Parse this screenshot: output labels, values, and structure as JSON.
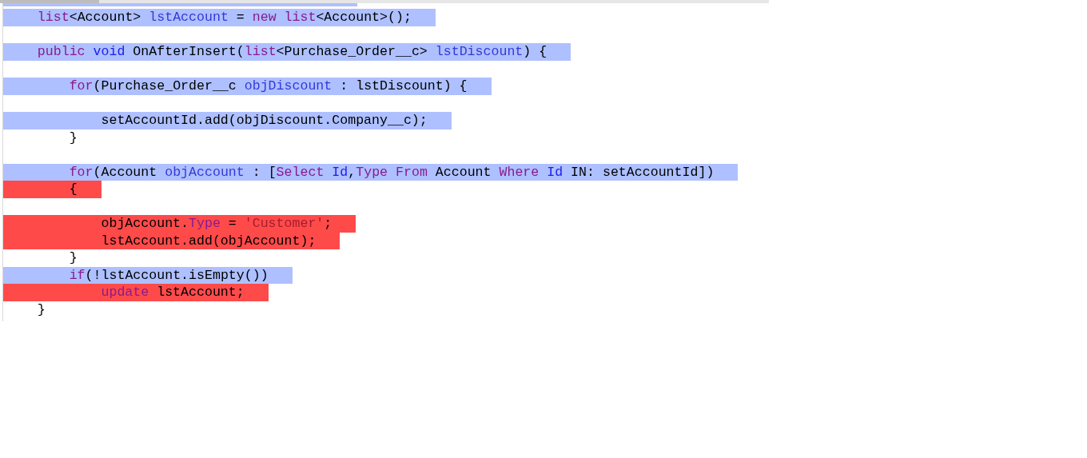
{
  "lines": [
    {
      "kind": "code",
      "color": "#aec0ff",
      "tokens": [
        {
          "kind": "keyword",
          "text": "    list"
        },
        {
          "kind": "plain",
          "text": "<Account> "
        },
        {
          "kind": "name",
          "text": "lstAccount"
        },
        {
          "kind": "plain",
          "text": " = "
        },
        {
          "kind": "keyword",
          "text": "new list"
        },
        {
          "kind": "plain",
          "text": "<Account>();"
        }
      ]
    },
    {
      "kind": "blank"
    },
    {
      "kind": "code",
      "color": "#aec0ff",
      "tokens": [
        {
          "kind": "keyword",
          "text": "    public "
        },
        {
          "kind": "builtin",
          "text": "void"
        },
        {
          "kind": "plain",
          "text": " OnAfterInsert("
        },
        {
          "kind": "keyword",
          "text": "list"
        },
        {
          "kind": "plain",
          "text": "<Purchase_Order__c> "
        },
        {
          "kind": "name",
          "text": "lstDiscount"
        },
        {
          "kind": "plain",
          "text": ") {"
        }
      ]
    },
    {
      "kind": "blank"
    },
    {
      "kind": "code",
      "color": "#aec0ff",
      "tokens": [
        {
          "kind": "keyword",
          "text": "        for"
        },
        {
          "kind": "plain",
          "text": "(Purchase_Order__c "
        },
        {
          "kind": "name",
          "text": "objDiscount"
        },
        {
          "kind": "plain",
          "text": " : lstDiscount) {"
        }
      ]
    },
    {
      "kind": "blank"
    },
    {
      "kind": "code",
      "color": "#aec0ff",
      "tokens": [
        {
          "kind": "plain",
          "text": "            setAccountId.add(objDiscount.Company__c);"
        }
      ]
    },
    {
      "kind": "code",
      "tokens": [
        {
          "kind": "plain",
          "text": "        }"
        }
      ]
    },
    {
      "kind": "blank"
    },
    {
      "kind": "code",
      "color": "#aec0ff",
      "tokens": [
        {
          "kind": "keyword",
          "text": "        for"
        },
        {
          "kind": "plain",
          "text": "(Account "
        },
        {
          "kind": "name",
          "text": "objAccount"
        },
        {
          "kind": "plain",
          "text": " : ["
        },
        {
          "kind": "keyword",
          "text": "Select "
        },
        {
          "kind": "builtin",
          "text": "Id"
        },
        {
          "kind": "plain",
          "text": ","
        },
        {
          "kind": "keyword",
          "text": "Type From"
        },
        {
          "kind": "plain",
          "text": " Account "
        },
        {
          "kind": "keyword",
          "text": "Where "
        },
        {
          "kind": "builtin",
          "text": "Id"
        },
        {
          "kind": "plain",
          "text": " IN: setAccountId])"
        }
      ]
    },
    {
      "kind": "code",
      "color": "#ff4a4a",
      "tokens": [
        {
          "kind": "plain",
          "text": "        {"
        }
      ]
    },
    {
      "kind": "blank"
    },
    {
      "kind": "code",
      "color": "#ff4a4a",
      "tokens": [
        {
          "kind": "plain",
          "text": "            objAccount."
        },
        {
          "kind": "keyword",
          "text": "Type"
        },
        {
          "kind": "plain",
          "text": " = "
        },
        {
          "kind": "string",
          "text": "'Customer'"
        },
        {
          "kind": "plain",
          "text": ";"
        }
      ]
    },
    {
      "kind": "code",
      "color": "#ff4a4a",
      "tokens": [
        {
          "kind": "plain",
          "text": "            lstAccount.add(objAccount);"
        }
      ]
    },
    {
      "kind": "code",
      "tokens": [
        {
          "kind": "plain",
          "text": "        }"
        }
      ]
    },
    {
      "kind": "code",
      "color": "#aec0ff",
      "tokens": [
        {
          "kind": "keyword",
          "text": "        if"
        },
        {
          "kind": "plain",
          "text": "(!lstAccount.isEmpty())"
        }
      ]
    },
    {
      "kind": "code",
      "color": "#ff4a4a",
      "tokens": [
        {
          "kind": "keyword",
          "text": "            update"
        },
        {
          "kind": "plain",
          "text": " lstAccount;"
        }
      ]
    },
    {
      "kind": "code",
      "tokens": [
        {
          "kind": "plain",
          "text": "    }"
        }
      ]
    }
  ]
}
